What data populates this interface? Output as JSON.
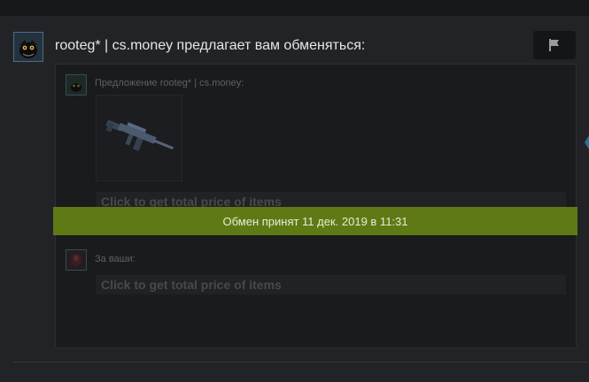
{
  "header": {
    "text": "rooteg* | cs.money предлагает вам обменяться:",
    "report_icon": "flag-icon"
  },
  "offer": {
    "their_label": "Предложение rooteg* | cs.money:",
    "their_item_icon": "rifle-icon",
    "their_price_text": "Click to get total price of items",
    "your_label": "За ваши:",
    "your_price_text": "Click to get total price of items"
  },
  "status": {
    "text": "Обмен принят 11 дек. 2019 в 11:31",
    "color": "#5f7a14"
  }
}
